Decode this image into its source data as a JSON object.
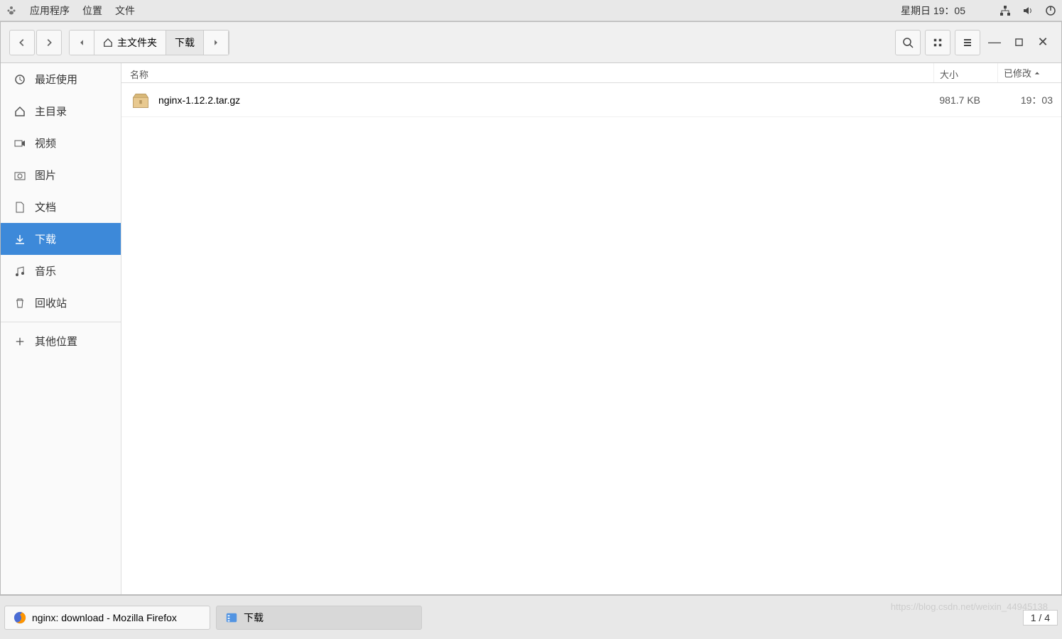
{
  "system": {
    "menus": [
      "应用程序",
      "位置",
      "文件"
    ],
    "clock": "星期日 19：05"
  },
  "toolbar": {
    "path_home": "主文件夹",
    "path_current": "下载"
  },
  "sidebar": {
    "items": [
      {
        "icon": "clock",
        "label": "最近使用"
      },
      {
        "icon": "home",
        "label": "主目录"
      },
      {
        "icon": "video",
        "label": "视频"
      },
      {
        "icon": "camera",
        "label": "图片"
      },
      {
        "icon": "doc",
        "label": "文档"
      },
      {
        "icon": "download",
        "label": "下载"
      },
      {
        "icon": "music",
        "label": "音乐"
      },
      {
        "icon": "trash",
        "label": "回收站"
      }
    ],
    "other": "其他位置"
  },
  "list": {
    "headers": {
      "name": "名称",
      "size": "大小",
      "modified": "已修改"
    },
    "rows": [
      {
        "name": "nginx-1.12.2.tar.gz",
        "size": "981.7 KB",
        "modified": "19：03"
      }
    ]
  },
  "taskbar": {
    "items": [
      {
        "icon": "firefox",
        "label": "nginx: download - Mozilla Firefox"
      },
      {
        "icon": "files",
        "label": "下载"
      }
    ],
    "page": "1 / 4"
  },
  "watermark": "https://blog.csdn.net/weixin_44945138"
}
